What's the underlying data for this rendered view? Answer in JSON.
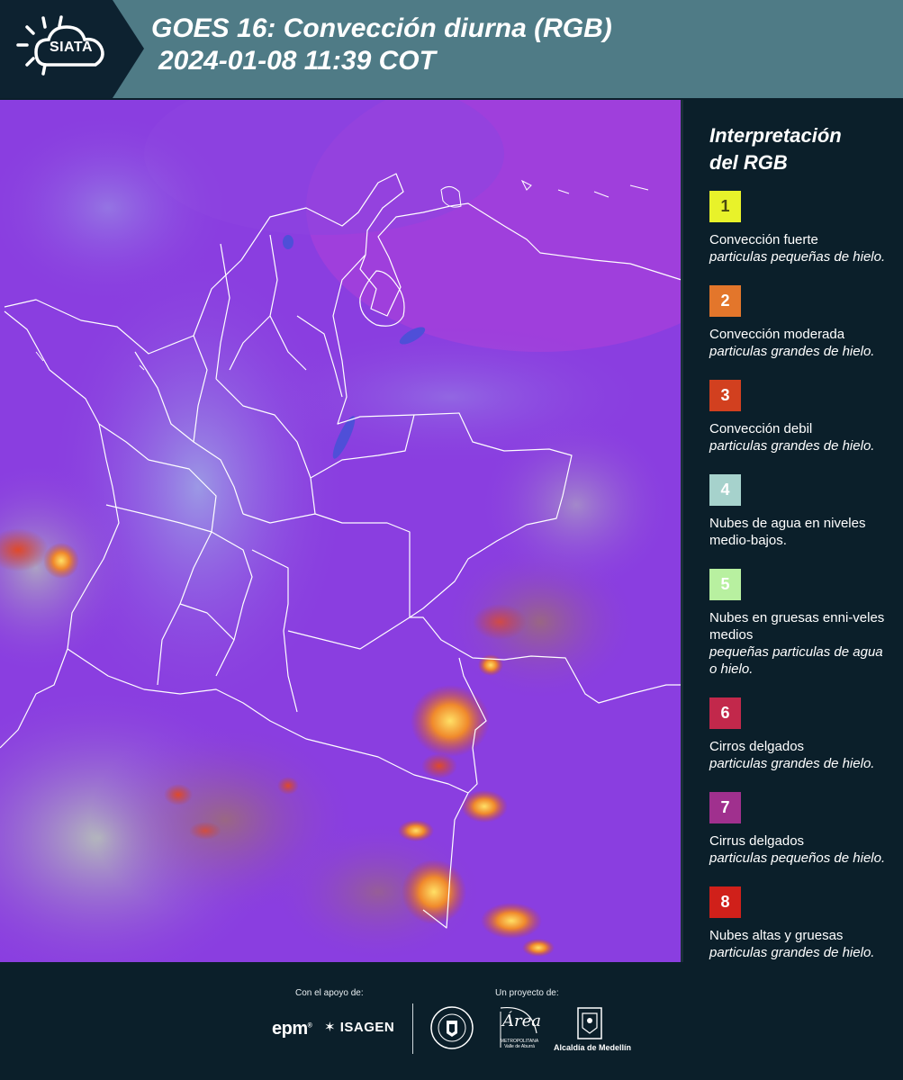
{
  "header": {
    "logo_text": "SIATA",
    "title_line1": "GOES 16: Convección diurna (RGB)",
    "title_line2": "2024-01-08 11:39 COT"
  },
  "map": {
    "background_color": "#8a3ee0",
    "border_color": "#ffffff"
  },
  "legend": {
    "title_line1": "Interpretación",
    "title_line2": "del RGB",
    "items": [
      {
        "number": "1",
        "color": "#e8f22a",
        "number_color": "#4a4a10",
        "label": "Convección fuerte",
        "sublabel": "particulas pequeñas de hielo."
      },
      {
        "number": "2",
        "color": "#e3762b",
        "number_color": "#ffffff",
        "label": "Convección moderada",
        "sublabel": "particulas grandes de hielo."
      },
      {
        "number": "3",
        "color": "#d2401f",
        "number_color": "#ffffff",
        "label": "Convección debil",
        "sublabel": "particulas grandes de hielo."
      },
      {
        "number": "4",
        "color": "#a6d2cc",
        "number_color": "#ffffff",
        "label": "Nubes de agua en niveles medio-bajos.",
        "sublabel": ""
      },
      {
        "number": "5",
        "color": "#b8f0a0",
        "number_color": "#ffffff",
        "label": "Nubes en gruesas enni-veles medios",
        "sublabel": "pequeñas particulas de agua o hielo."
      },
      {
        "number": "6",
        "color": "#c2284b",
        "number_color": "#ffffff",
        "label": "Cirros delgados",
        "sublabel": "particulas grandes de hielo."
      },
      {
        "number": "7",
        "color": "#a0308e",
        "number_color": "#ffffff",
        "label": "Cirrus delgados",
        "sublabel": "particulas pequeños de hielo."
      },
      {
        "number": "8",
        "color": "#d0201a",
        "number_color": "#ffffff",
        "label": "Nubes altas y gruesas",
        "sublabel": "particulas grandes de hielo."
      }
    ]
  },
  "footer": {
    "support_label": "Con el apoyo de:",
    "project_label": "Un proyecto de:",
    "sponsor1": "epm",
    "sponsor2": "ISAGEN",
    "area_word": "Área",
    "area_sub": "METROPOLITANA Valle de Aburrá",
    "alcaldia": "Alcaldía de Medellín"
  }
}
